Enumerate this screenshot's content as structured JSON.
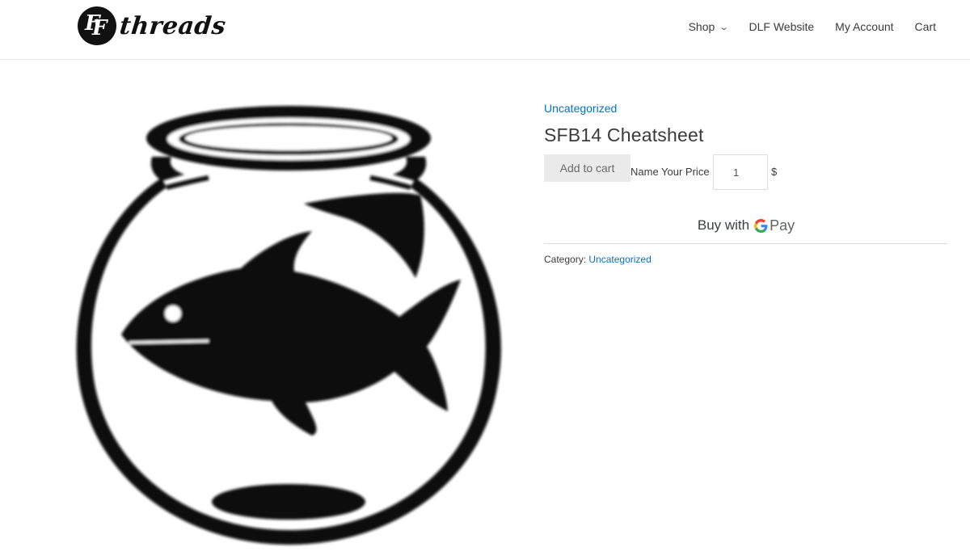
{
  "header": {
    "logo_text": "threads",
    "nav": [
      {
        "label": "Shop",
        "has_dropdown": true
      },
      {
        "label": "DLF Website"
      },
      {
        "label": "My Account"
      },
      {
        "label": "Cart"
      }
    ]
  },
  "product": {
    "image_icon": "fishbowl-icon",
    "category_link": "Uncategorized",
    "title": "SFB14 Cheatsheet",
    "add_to_cart_label": "Add to cart",
    "name_your_price_label": "Name Your Price",
    "price_value": "1",
    "currency_symbol": "$",
    "gpay": {
      "prefix": "Buy with",
      "brand": "Pay"
    },
    "meta": {
      "category_label": "Category:",
      "category_value": "Uncategorized"
    }
  },
  "colors": {
    "link": "#0274be",
    "text": "#3a3a3a",
    "button_bg": "#eaeaea"
  }
}
